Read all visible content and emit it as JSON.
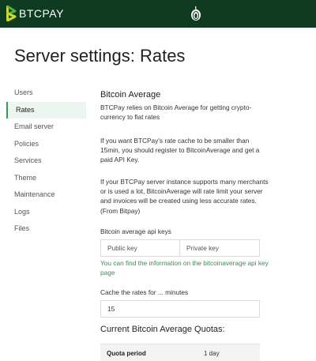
{
  "header": {
    "logo_text": "BTCPAY",
    "colors": {
      "bar": "#0f3b21",
      "accent": "#2e9e55"
    },
    "right_icon": "tor-onion-icon"
  },
  "page": {
    "title": "Server settings: Rates"
  },
  "sidebar": {
    "items": [
      {
        "label": "Users",
        "active": false
      },
      {
        "label": "Rates",
        "active": true
      },
      {
        "label": "Email server",
        "active": false
      },
      {
        "label": "Policies",
        "active": false
      },
      {
        "label": "Services",
        "active": false
      },
      {
        "label": "Theme",
        "active": false
      },
      {
        "label": "Maintenance",
        "active": false
      },
      {
        "label": "Logs",
        "active": false
      },
      {
        "label": "Files",
        "active": false
      }
    ]
  },
  "main": {
    "section_title": "Bitcoin Average",
    "paragraphs": [
      "BTCPay relies on Bitcoin Average for getting crypto-currency to fiat rates",
      "If you want BTCPay's rate cache to be smaller than 15min, you should register to BitcoinAverage and get a paid API Key.",
      "If your BTCPay server instance supports many merchants or is used a lot, BitcoinAverage will rate limit your server and invoices will be created using less accurate rates. (From Bitpay)"
    ],
    "api_keys": {
      "label": "Bitcoin average api keys",
      "public_placeholder": "Public key",
      "private_placeholder": "Private key",
      "hint_prefix": "You can find the information on the ",
      "hint_link": "bitcoinaverage api key page"
    },
    "cache": {
      "label": "Cache the rates for ... minutes",
      "value": "15"
    },
    "quotas": {
      "title": "Current Bitcoin Average Quotas:",
      "header": "Quota period",
      "value": "1 day"
    }
  }
}
